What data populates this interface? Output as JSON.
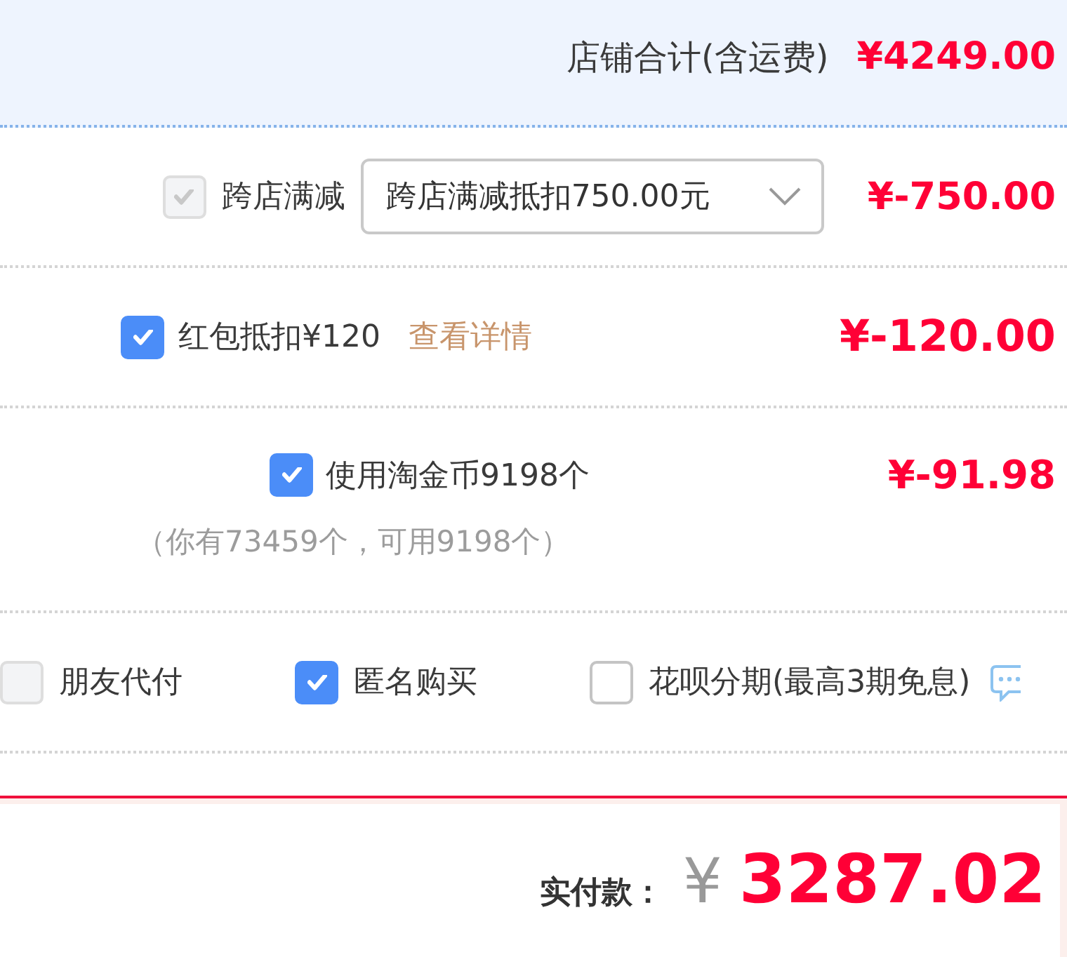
{
  "shop_total": {
    "label": "店铺合计(含运费)",
    "amount": "¥4249.00"
  },
  "discounts": [
    {
      "kind": "select",
      "checked": true,
      "disabled": true,
      "label": "跨店满减",
      "select_value": "跨店满减抵扣750.00元",
      "amount": "¥-750.00"
    },
    {
      "kind": "link",
      "checked": true,
      "disabled": false,
      "label": "红包抵扣¥120",
      "link": "查看详情",
      "amount": "¥-120.00"
    },
    {
      "kind": "note",
      "checked": true,
      "disabled": false,
      "label": "使用淘金币9198个",
      "note": "（你有73459个，可用9198个）",
      "amount": "¥-91.98"
    }
  ],
  "options": [
    {
      "label": "朋友代付",
      "checked": false,
      "disabled": true
    },
    {
      "label": "匿名购买",
      "checked": true,
      "disabled": false
    },
    {
      "label": "花呗分期(最高3期免息)",
      "checked": false,
      "disabled": false
    }
  ],
  "total": {
    "label": "实付款：",
    "currency": "¥",
    "amount": "3287.02"
  }
}
